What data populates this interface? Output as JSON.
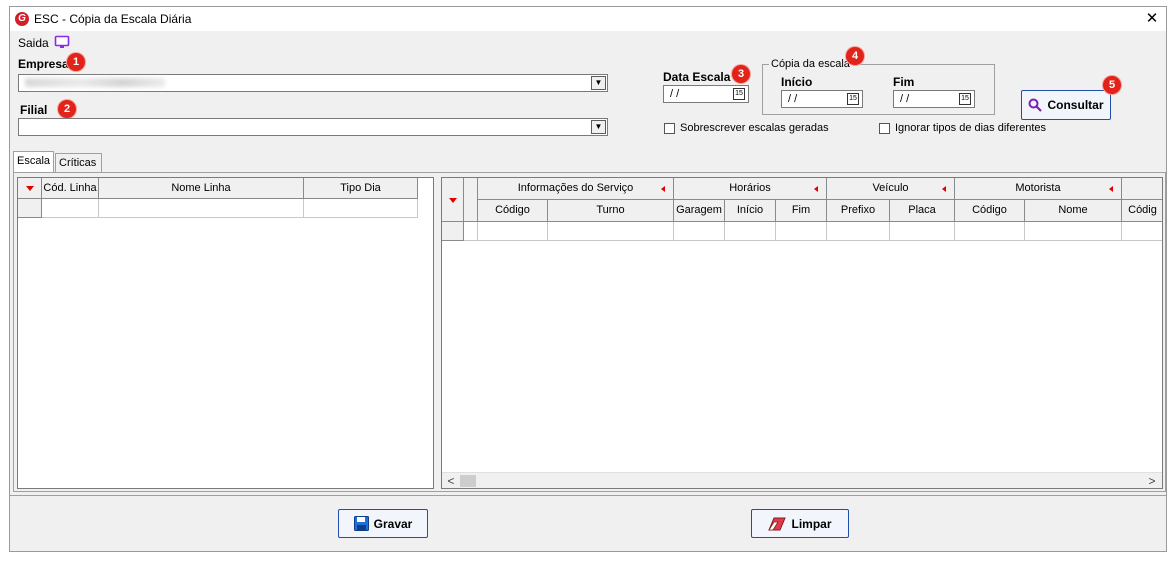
{
  "window": {
    "title": "ESC - Cópia da Escala Diária",
    "app_icon_letter": "G",
    "close_glyph": "✕"
  },
  "menu": {
    "saida_label": "Saida"
  },
  "badges": {
    "b1": "1",
    "b2": "2",
    "b3": "3",
    "b4": "4",
    "b5": "5"
  },
  "empresa": {
    "label": "Empresa",
    "value": ""
  },
  "filial": {
    "label": "Filial",
    "value": ""
  },
  "data_escala": {
    "label": "Data Escala",
    "value": "/ /",
    "cal_text": "15"
  },
  "copia": {
    "legend": "Cópia da escala",
    "inicio_label": "Início",
    "inicio_value": "/ /",
    "fim_label": "Fim",
    "fim_value": "/ /",
    "cal_text": "15"
  },
  "options": {
    "sobrescrever_label": "Sobrescrever escalas geradas",
    "ignorar_label": "Ignorar tipos de dias diferentes"
  },
  "buttons": {
    "consultar": "Consultar",
    "gravar": "Gravar",
    "limpar": "Limpar"
  },
  "tabs": [
    "Escala",
    "Críticas"
  ],
  "left_grid": {
    "columns": [
      "Cód. Linha",
      "Nome Linha",
      "Tipo Dia"
    ]
  },
  "right_grid": {
    "groups": [
      "Informações do Serviço",
      "Horários",
      "Veículo",
      "Motorista"
    ],
    "columns": [
      "Código",
      "Turno",
      "Garagem",
      "Início",
      "Fim",
      "Prefixo",
      "Placa",
      "Código",
      "Nome",
      "Códig"
    ]
  },
  "scroll": {
    "left_arrow": "<",
    "right_arrow": ">"
  },
  "colors": {
    "accent": "#1f4fa8",
    "badge": "#e2231a",
    "sort_marker": "#e00000",
    "monitor_icon": "#8a2be2"
  }
}
